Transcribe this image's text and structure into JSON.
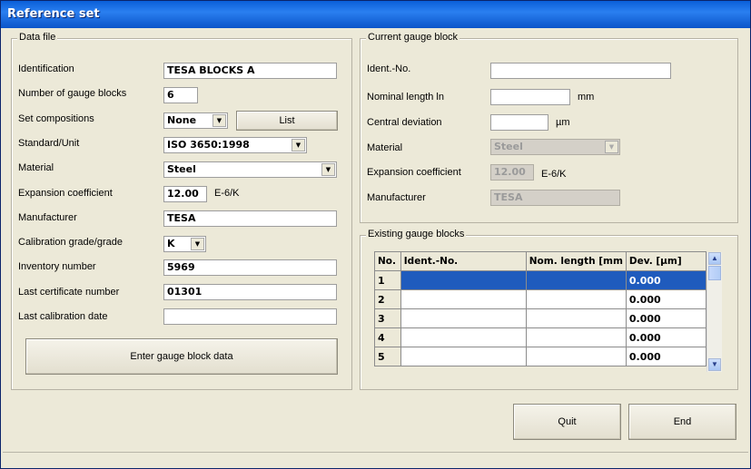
{
  "window": {
    "title": "Reference set"
  },
  "data_file": {
    "legend": "Data file",
    "identification": {
      "label": "Identification",
      "value": "TESA BLOCKS A"
    },
    "number_of_blocks": {
      "label": "Number of gauge blocks",
      "value": "6"
    },
    "set_compositions": {
      "label": "Set compositions",
      "value": "None",
      "list_button": "List"
    },
    "standard_unit": {
      "label": "Standard/Unit",
      "value": "ISO 3650:1998"
    },
    "material": {
      "label": "Material",
      "value": "Steel"
    },
    "expansion": {
      "label": "Expansion coefficient",
      "value": "12.00",
      "unit": "E-6/K"
    },
    "manufacturer": {
      "label": "Manufacturer",
      "value": "TESA"
    },
    "calibration_grade": {
      "label": "Calibration grade/grade",
      "value": "K"
    },
    "inventory_number": {
      "label": "Inventory number",
      "value": "5969"
    },
    "last_certificate": {
      "label": "Last certificate number",
      "value": "01301"
    },
    "last_calibration_date": {
      "label": "Last calibration date",
      "value": ""
    },
    "enter_button": "Enter gauge block data"
  },
  "current_block": {
    "legend": "Current gauge block",
    "ident_no": {
      "label": "Ident.-No.",
      "value": ""
    },
    "nominal_length": {
      "label": "Nominal length ln",
      "value": "",
      "unit": "mm"
    },
    "central_deviation": {
      "label": "Central deviation",
      "value": "",
      "unit": "µm"
    },
    "material": {
      "label": "Material",
      "value": "Steel"
    },
    "expansion": {
      "label": "Expansion coefficient",
      "value": "12.00",
      "unit": "E-6/K"
    },
    "manufacturer": {
      "label": "Manufacturer",
      "value": "TESA"
    }
  },
  "existing_blocks": {
    "legend": "Existing gauge blocks",
    "columns": [
      "No.",
      "Ident.-No.",
      "Nom. length [mm",
      "Dev. [µm]"
    ],
    "rows": [
      {
        "no": "1",
        "ident": "",
        "length": "",
        "dev": "0.000"
      },
      {
        "no": "2",
        "ident": "",
        "length": "",
        "dev": "0.000"
      },
      {
        "no": "3",
        "ident": "",
        "length": "",
        "dev": "0.000"
      },
      {
        "no": "4",
        "ident": "",
        "length": "",
        "dev": "0.000"
      },
      {
        "no": "5",
        "ident": "",
        "length": "",
        "dev": "0.000"
      }
    ]
  },
  "buttons": {
    "quit": "Quit",
    "end": "End"
  },
  "colors": {
    "title_bar": "#0a5fd8",
    "selection": "#1f5bbd",
    "dialog_bg": "#ece9d8"
  }
}
